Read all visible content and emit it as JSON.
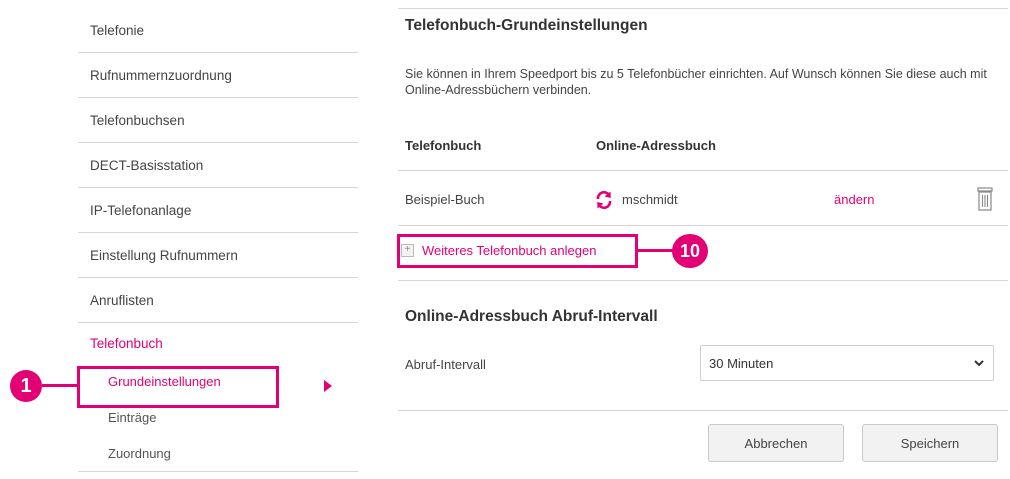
{
  "sidebar": {
    "items": [
      {
        "label": "Telefonie"
      },
      {
        "label": "Rufnummernzuordnung"
      },
      {
        "label": "Telefonbuchsen"
      },
      {
        "label": "DECT-Basisstation"
      },
      {
        "label": "IP-Telefonanlage"
      },
      {
        "label": "Einstellung Rufnummern"
      },
      {
        "label": "Anruflisten"
      }
    ],
    "active": {
      "label": "Telefonbuch"
    },
    "subitems": [
      {
        "label": "Grundeinstellungen"
      },
      {
        "label": "Einträge"
      },
      {
        "label": "Zuordnung"
      }
    ]
  },
  "annotations": {
    "one": "1",
    "two": "10"
  },
  "main": {
    "title": "Telefonbuch-Grundeinstellungen",
    "description": "Sie können in Ihrem Speedport bis zu 5 Telefonbücher einrichten. Auf Wunsch können Sie diese auch mit Online-Adressbüchern verbinden.",
    "table": {
      "col_phonebook": "Telefonbuch",
      "col_online": "Online-Adressbuch",
      "row": {
        "name": "Beispiel-Buch",
        "online_user": "mschmidt",
        "edit": "ändern"
      }
    },
    "add_link": "Weiteres Telefonbuch anlegen",
    "section2_title": "Online-Adressbuch Abruf-Intervall",
    "interval_label": "Abruf-Intervall",
    "interval_value": "30 Minuten",
    "cancel_label": "Abbrechen",
    "save_label": "Speichern"
  },
  "colors": {
    "accent": "#e20074"
  },
  "icons": [
    "sync-icon",
    "trash-icon",
    "plus-icon",
    "chevron-down-icon",
    "arrow-right-icon"
  ]
}
